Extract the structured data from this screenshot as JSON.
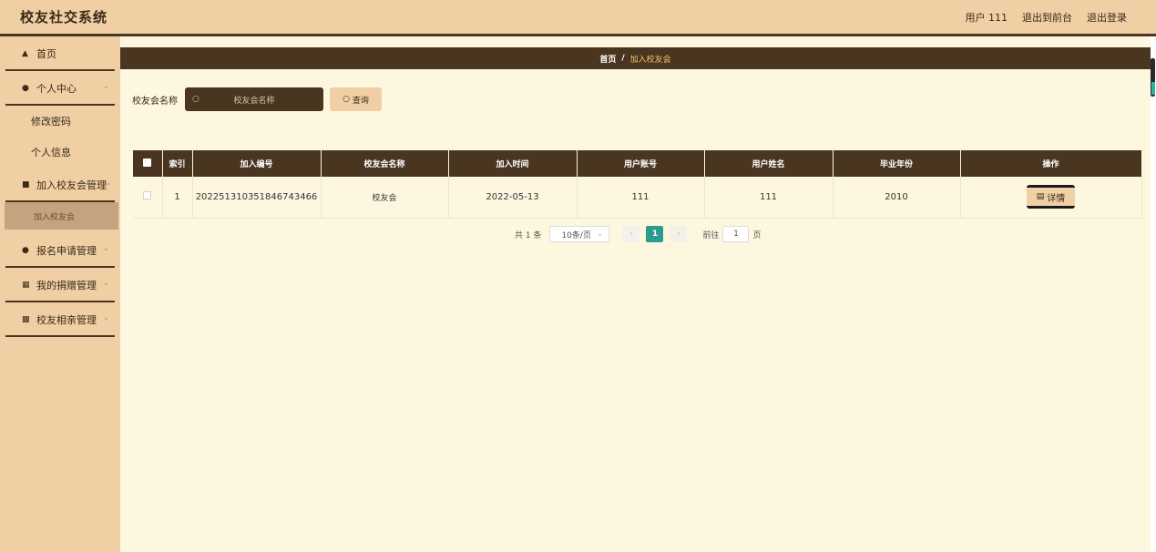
{
  "header": {
    "title": "校友社交系统",
    "user_label": "用户 111",
    "front_link": "退出到前台",
    "logout_link": "退出登录"
  },
  "sidebar": {
    "items": [
      {
        "label": "首页",
        "icon": "home-icon"
      },
      {
        "label": "个人中心",
        "icon": "user-icon",
        "children": [
          "修改密码",
          "个人信息"
        ]
      },
      {
        "label": "加入校友会管理",
        "icon": "thumb-icon",
        "children": [
          "加入校友会"
        ]
      },
      {
        "label": "报名申请管理",
        "icon": "pin-icon"
      },
      {
        "label": "我的捐赠管理",
        "icon": "grid-icon"
      },
      {
        "label": "校友相亲管理",
        "icon": "apps-icon"
      }
    ]
  },
  "breadcrumb": {
    "home": "首页",
    "separator": "/",
    "current": "加入校友会"
  },
  "search": {
    "label": "校友会名称",
    "placeholder": "校友会名称",
    "button": "查询"
  },
  "table": {
    "headers": [
      "索引",
      "加入编号",
      "校友会名称",
      "加入时间",
      "用户账号",
      "用户姓名",
      "毕业年份",
      "操作"
    ],
    "rows": [
      {
        "index": "1",
        "join_no": "20225131035184674346​6",
        "club_name": "校友会",
        "join_time": "2022-05-13",
        "account": "111",
        "name": "111",
        "grad_year": "2010",
        "action": "详情"
      }
    ]
  },
  "pagination": {
    "total": "共 1 条",
    "page_size": "10条/页",
    "current_page": "1",
    "goto_label": "前往",
    "goto_value": "1",
    "page_unit": "页"
  },
  "colors": {
    "accent_dark": "#4a3520",
    "accent_light": "#efcfa3",
    "background": "#fdf7e0",
    "active_page": "#2a9d8f"
  }
}
